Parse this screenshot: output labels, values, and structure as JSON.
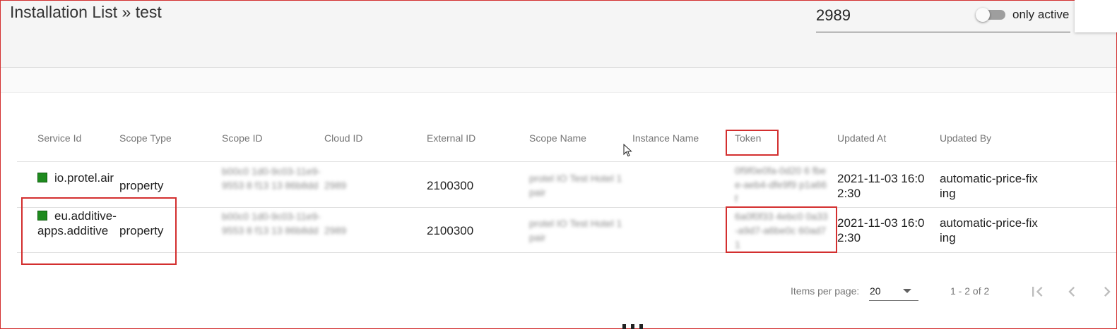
{
  "header": {
    "title": "Installation List » test",
    "search_value": "2989",
    "toggle_label": "only active"
  },
  "table": {
    "columns": [
      "Service Id",
      "Scope Type",
      "Scope ID",
      "Cloud ID",
      "External ID",
      "Scope Name",
      "Instance Name",
      "Token",
      "Updated At",
      "Updated By"
    ],
    "rows": [
      {
        "status_color": "#1e8a1e",
        "service_id": "io.protel.air",
        "scope_type": "property",
        "scope_id": "b00c0 1d0-9c03-11e9-9553 8 f13 13 86b8dd",
        "cloud_id": "2989",
        "external_id": "2100300",
        "scope_name": "protel IO Test Hotel 1 pair",
        "instance_name": "",
        "token": "0f9f0e0fa-0d20 6 fbee-aeb4-dfe9f9 p1a66 f",
        "updated_at": "2021-11-03 16:02:30",
        "updated_by": "automatic-price-fixing"
      },
      {
        "status_color": "#1e8a1e",
        "service_id": "eu.additive-apps.additive",
        "scope_type": "property",
        "scope_id": "b00c0 1d0-9c03-11e9-9553 8 f13 13 86b8dd",
        "cloud_id": "2989",
        "external_id": "2100300",
        "scope_name": "protel IO Test Hotel 1 pair",
        "instance_name": "",
        "token": "6a0f0f33 4ebc0 0a33-a9d7-a6be0c 60ad71",
        "updated_at": "2021-11-03 16:02:30",
        "updated_by": "automatic-price-fixing"
      }
    ]
  },
  "paginator": {
    "items_per_page_label": "Items per page:",
    "page_size": "20",
    "range_label": "1 - 2 of 2"
  },
  "icons": {
    "first_page": "first-page-icon",
    "prev_page": "chevron-left-icon",
    "next_page": "chevron-right-icon",
    "cursor": "mouse-cursor-icon"
  }
}
